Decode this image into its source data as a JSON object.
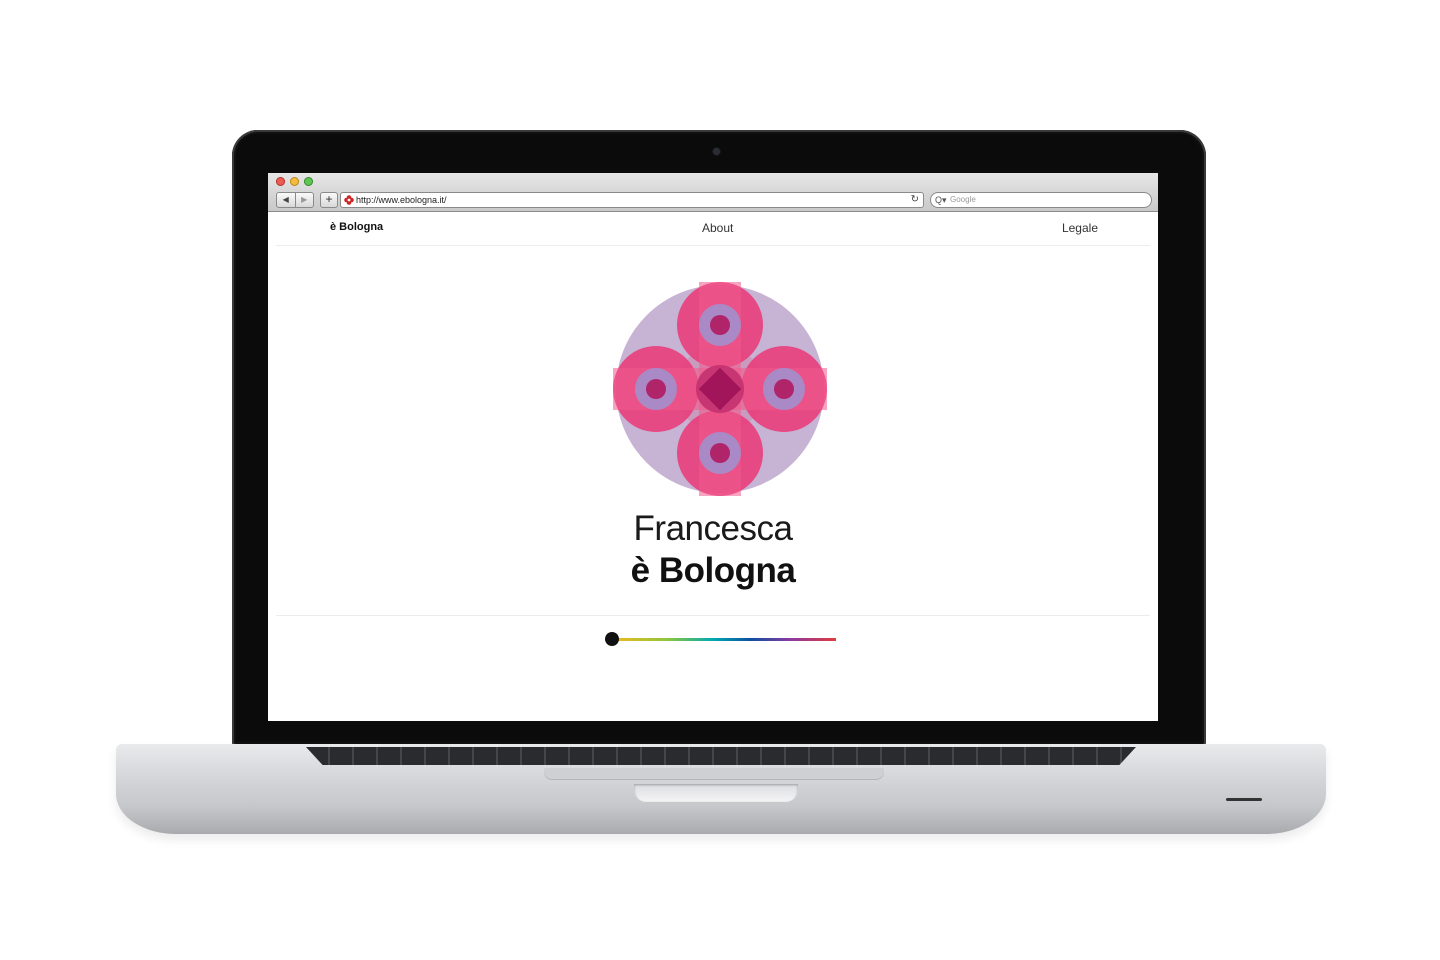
{
  "browser": {
    "url": "http://www.ebologna.it/",
    "search_placeholder": "Google",
    "back_glyph": "◀",
    "forward_glyph": "▶",
    "add_glyph": "+",
    "reload_glyph": "↻",
    "search_glyph": "Q▾"
  },
  "nav": {
    "brand": "è Bologna",
    "about": "About",
    "legale": "Legale"
  },
  "hero": {
    "line1": "Francesca",
    "line2": "è Bologna"
  },
  "timeline": {
    "position": 0
  },
  "colors": {
    "logo_pink": "#e83e7b",
    "logo_lilac": "#b49ac4",
    "logo_purple": "#8a4a9c",
    "timeline_knob": "#111111"
  }
}
